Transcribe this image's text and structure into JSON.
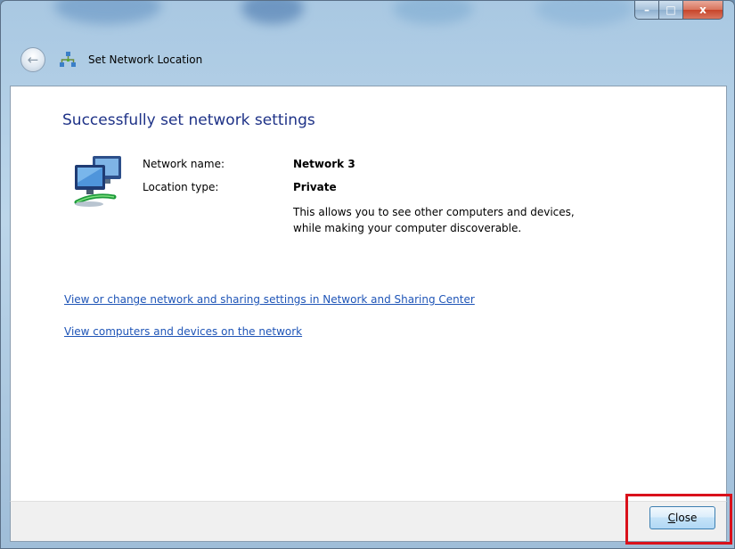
{
  "window": {
    "title": "Set Network Location",
    "controls": {
      "minimize": "–",
      "maximize": "□",
      "close": "x"
    }
  },
  "navigation": {
    "back_icon": "back-arrow-icon",
    "title_icon": "network-icon",
    "title": "Set Network Location"
  },
  "main": {
    "heading": "Successfully set network settings",
    "icon": "network-computers-icon",
    "network_name_label": "Network name:",
    "network_name_value": "Network 3",
    "location_type_label": "Location type:",
    "location_type_value": "Private",
    "location_description": "This allows you to see other computers and devices, while making your computer discoverable.",
    "links": [
      "View or change network and sharing settings in Network and Sharing Center",
      "View computers and devices on the network"
    ]
  },
  "footer": {
    "close_accesskey": "C",
    "close_rest": "lose"
  },
  "colors": {
    "heading": "#1e3287",
    "link": "#1f55b7",
    "highlight": "#d9111b"
  }
}
